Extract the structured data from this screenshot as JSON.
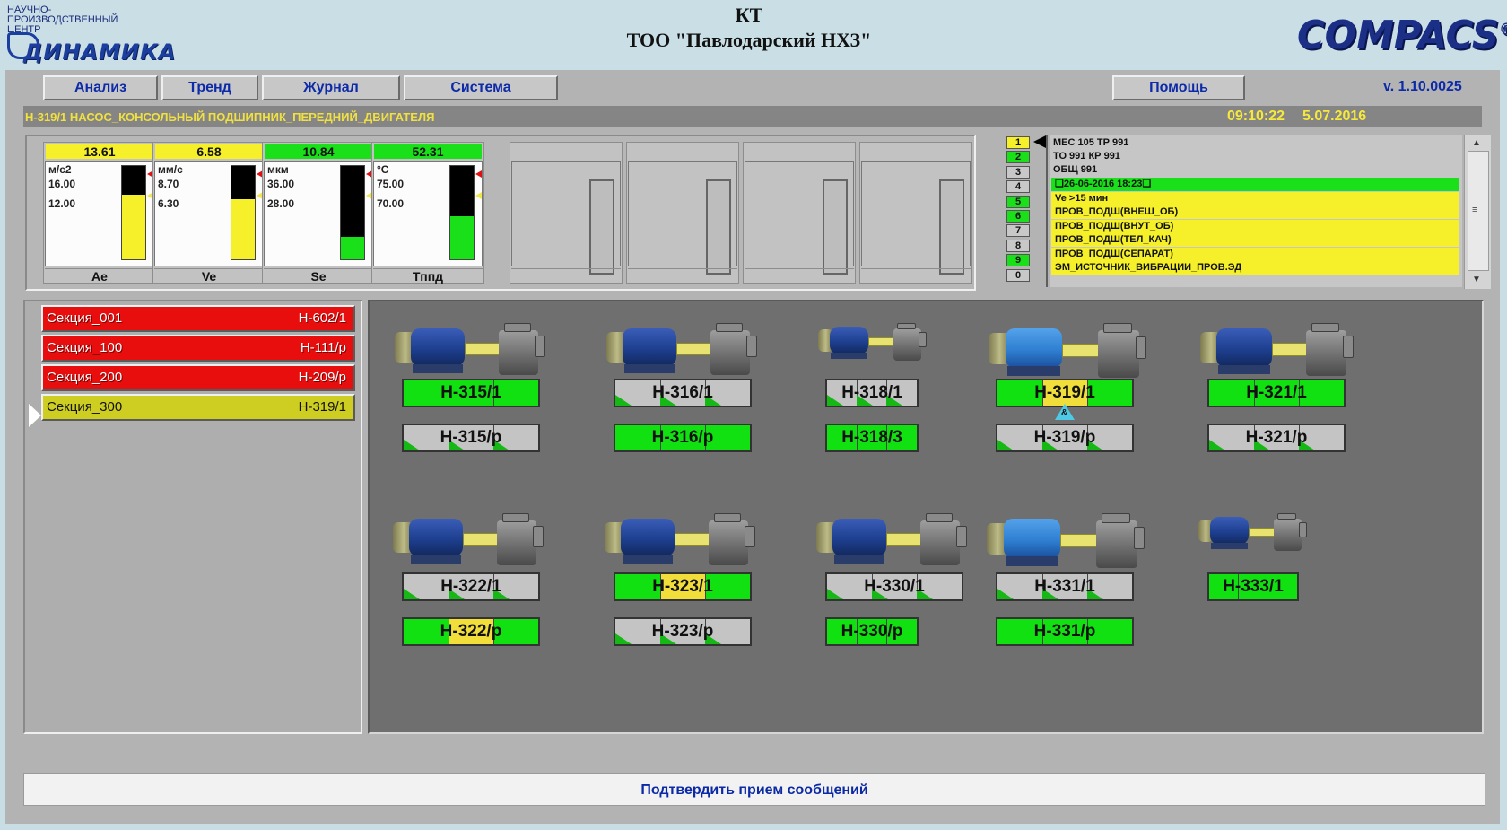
{
  "header": {
    "logo_left": {
      "lines": [
        "НАУЧНО-",
        "ПРОИЗВОДСТВЕННЫЙ",
        "ЦЕНТР"
      ],
      "word": "ДИНАМИКА"
    },
    "title_line1": "КТ",
    "title_line2": "ТОО \"Павлодарский НХЗ\"",
    "logo_right": "COMPACS",
    "logo_right_mark": "®"
  },
  "menu": {
    "analysis": "Анализ",
    "trend": "Тренд",
    "journal": "Журнал",
    "system": "Система",
    "help": "Помощь",
    "version": "v. 1.10.0025"
  },
  "status": {
    "text": "Н-319/1   НАСОС_КОНСОЛЬНЫЙ   ПОДШИПНИК_ПЕРЕДНИЙ_ДВИГАТЕЛЯ",
    "time": "09:10:22",
    "date": "5.07.2016"
  },
  "gauges": [
    {
      "value": "13.61",
      "unit": "м/с2",
      "thr1": "16.00",
      "thr2": "12.00",
      "label": "Ae",
      "value_bg": "#f5f02a",
      "fill_color": "#f5f02a",
      "fill_fraction": 0.69
    },
    {
      "value": "6.58",
      "unit": "мм/с",
      "thr1": "8.70",
      "thr2": "6.30",
      "label": "Ve",
      "value_bg": "#f5f02a",
      "fill_color": "#f5f02a",
      "fill_fraction": 0.64
    },
    {
      "value": "10.84",
      "unit": "мкм",
      "thr1": "36.00",
      "thr2": "28.00",
      "label": "Se",
      "value_bg": "#19e019",
      "fill_color": "#19e019",
      "fill_fraction": 0.24
    },
    {
      "value": "52.31",
      "unit": "°С",
      "thr1": "75.00",
      "thr2": "70.00",
      "label": "Тппд",
      "value_bg": "#19e019",
      "fill_color": "#19e019",
      "fill_fraction": 0.46
    }
  ],
  "channels": [
    {
      "label": "1",
      "color": "#f5f02a"
    },
    {
      "label": "2",
      "color": "#19e019"
    },
    {
      "label": "3",
      "color": "#c8c8c8"
    },
    {
      "label": "4",
      "color": "#c8c8c8"
    },
    {
      "label": "5",
      "color": "#19e019"
    },
    {
      "label": "6",
      "color": "#19e019"
    },
    {
      "label": "7",
      "color": "#c8c8c8"
    },
    {
      "label": "8",
      "color": "#c8c8c8"
    },
    {
      "label": "9",
      "color": "#19e019"
    },
    {
      "label": "0",
      "color": "#c8c8c8"
    }
  ],
  "eventlog": {
    "line1": "МЕС 105   ТР 991",
    "line2": " ТО 991   КР 991",
    "line3": "ОБЩ 991",
    "rows": [
      {
        "text": "❑26-06-2016 18:23❑",
        "color": "#19e019"
      },
      {
        "text": "Ve >15 мин",
        "color": "#f5f02a"
      },
      {
        "text": "ПРОВ_ПОДШ(ВНЕШ_ОБ)",
        "color": "#f5f02a"
      },
      {
        "text": "ПРОВ_ПОДШ(ВНУТ_ОБ)",
        "color": "#f5f02a"
      },
      {
        "text": "ПРОВ_ПОДШ(ТЕЛ_КАЧ)",
        "color": "#f5f02a"
      },
      {
        "text": "ПРОВ_ПОДШ(СЕПАРАТ)",
        "color": "#f5f02a"
      },
      {
        "text": "ЭМ_ИСТОЧНИК_ВИБРАЦИИ_ПРОВ.ЭД",
        "color": "#f5f02a"
      }
    ],
    "scroll_up": "▲",
    "scroll_down": "▼",
    "scroll_grip": "≡"
  },
  "sections": [
    {
      "name": "Секция_001",
      "unit": "Н-602/1",
      "state": "red"
    },
    {
      "name": "Секция_100",
      "unit": "Н-111/р",
      "state": "red"
    },
    {
      "name": "Секция_200",
      "unit": "Н-209/р",
      "state": "red"
    },
    {
      "name": "Секция_300",
      "unit": "Н-319/1",
      "state": "active"
    }
  ],
  "pumps": [
    {
      "tag": "Н-315/1",
      "style": "green",
      "motor": "dark"
    },
    {
      "tag": "Н-316/1",
      "style": "grey",
      "motor": "dark"
    },
    {
      "tag": "Н-318/1",
      "style": "grey",
      "motor": "dark"
    },
    {
      "tag": "Н-319/1",
      "style": "green",
      "motor": "light",
      "highlight": true,
      "badge": "&"
    },
    {
      "tag": "Н-321/1",
      "style": "green",
      "motor": "dark"
    },
    {
      "tag": "Н-322/1",
      "style": "grey",
      "motor": "dark"
    },
    {
      "tag": "Н-323/1",
      "style": "green",
      "motor": "dark",
      "highlight": true
    },
    {
      "tag": "Н-330/1",
      "style": "grey",
      "motor": "dark"
    },
    {
      "tag": "Н-331/1",
      "style": "grey",
      "motor": "light"
    },
    {
      "tag": "Н-333/1",
      "style": "green",
      "motor": "dark"
    }
  ],
  "reserves": [
    {
      "tag": "Н-315/р",
      "style": "grey"
    },
    {
      "tag": "Н-316/р",
      "style": "green"
    },
    {
      "tag": "Н-318/3",
      "style": "green"
    },
    {
      "tag": "Н-319/р",
      "style": "grey"
    },
    {
      "tag": "Н-321/р",
      "style": "grey"
    },
    {
      "tag": "Н-322/р",
      "style": "green",
      "highlight": true
    },
    {
      "tag": "Н-323/р",
      "style": "grey"
    },
    {
      "tag": "Н-330/р",
      "style": "green"
    },
    {
      "tag": "Н-331/р",
      "style": "green"
    }
  ],
  "confirm": "Подтвердить прием сообщений"
}
